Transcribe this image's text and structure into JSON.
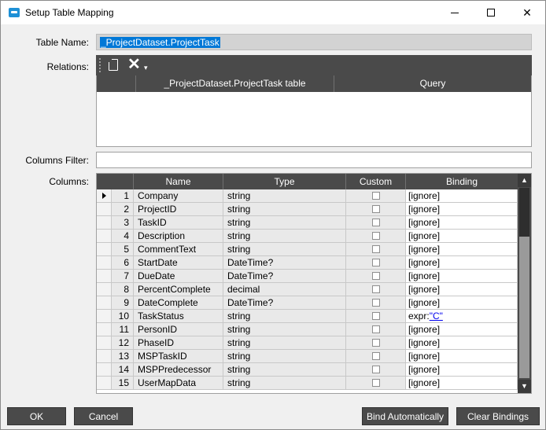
{
  "window": {
    "title": "Setup Table Mapping"
  },
  "form": {
    "table_name_label": "Table Name:",
    "table_name_value": "_ProjectDataset.ProjectTask",
    "relations_label": "Relations:",
    "columns_filter_label": "Columns Filter:",
    "columns_filter_value": "",
    "columns_label": "Columns:"
  },
  "relations": {
    "toolbar": {
      "new_icon": "new-document-icon",
      "delete_icon": "delete-x-icon"
    },
    "headers": [
      "_ProjectDataset.ProjectTask table",
      "Query"
    ],
    "rows": []
  },
  "columns": {
    "headers": {
      "name": "Name",
      "type": "Type",
      "custom": "Custom",
      "binding": "Binding"
    },
    "rows": [
      {
        "num": "1",
        "name": "Company",
        "type": "string",
        "custom": false,
        "binding": "[ignore]"
      },
      {
        "num": "2",
        "name": "ProjectID",
        "type": "string",
        "custom": false,
        "binding": "[ignore]"
      },
      {
        "num": "3",
        "name": "TaskID",
        "type": "string",
        "custom": false,
        "binding": "[ignore]"
      },
      {
        "num": "4",
        "name": "Description",
        "type": "string",
        "custom": false,
        "binding": "[ignore]"
      },
      {
        "num": "5",
        "name": "CommentText",
        "type": "string",
        "custom": false,
        "binding": "[ignore]"
      },
      {
        "num": "6",
        "name": "StartDate",
        "type": "DateTime?",
        "custom": false,
        "binding": "[ignore]"
      },
      {
        "num": "7",
        "name": "DueDate",
        "type": "DateTime?",
        "custom": false,
        "binding": "[ignore]"
      },
      {
        "num": "8",
        "name": "PercentComplete",
        "type": "decimal",
        "custom": false,
        "binding": "[ignore]"
      },
      {
        "num": "9",
        "name": "DateComplete",
        "type": "DateTime?",
        "custom": false,
        "binding": "[ignore]"
      },
      {
        "num": "10",
        "name": "TaskStatus",
        "type": "string",
        "custom": false,
        "binding": "expr:",
        "binding_link": "\"C\""
      },
      {
        "num": "11",
        "name": "PersonID",
        "type": "string",
        "custom": false,
        "binding": "[ignore]"
      },
      {
        "num": "12",
        "name": "PhaseID",
        "type": "string",
        "custom": false,
        "binding": "[ignore]"
      },
      {
        "num": "13",
        "name": "MSPTaskID",
        "type": "string",
        "custom": false,
        "binding": "[ignore]"
      },
      {
        "num": "14",
        "name": "MSPPredecessor",
        "type": "string",
        "custom": false,
        "binding": "[ignore]"
      },
      {
        "num": "15",
        "name": "UserMapData",
        "type": "string",
        "custom": false,
        "binding": "[ignore]"
      }
    ]
  },
  "buttons": {
    "ok": "OK",
    "cancel": "Cancel",
    "bind_automatically": "Bind Automatically",
    "clear_bindings": "Clear Bindings"
  }
}
